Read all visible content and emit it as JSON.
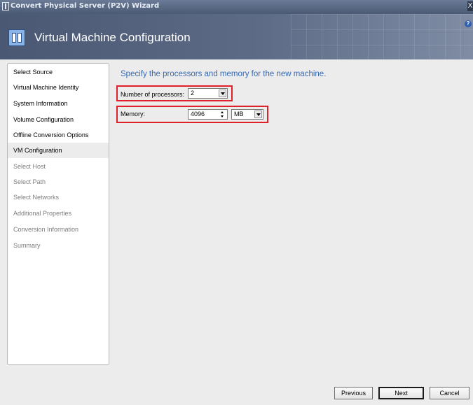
{
  "window": {
    "title": "Convert Physical Server (P2V) Wizard",
    "close_glyph": "X"
  },
  "banner": {
    "title": "Virtual Machine Configuration",
    "icon": "wizard-icon",
    "help_glyph": "?"
  },
  "nav": {
    "items": [
      {
        "label": "Select Source",
        "state": "done"
      },
      {
        "label": "Virtual Machine Identity",
        "state": "done"
      },
      {
        "label": "System Information",
        "state": "done"
      },
      {
        "label": "Volume Configuration",
        "state": "done"
      },
      {
        "label": "Offline Conversion Options",
        "state": "done"
      },
      {
        "label": "VM Configuration",
        "state": "active"
      },
      {
        "label": "Select Host",
        "state": "pending"
      },
      {
        "label": "Select Path",
        "state": "pending"
      },
      {
        "label": "Select Networks",
        "state": "pending"
      },
      {
        "label": "Additional Properties",
        "state": "pending"
      },
      {
        "label": "Conversion Information",
        "state": "pending"
      },
      {
        "label": "Summary",
        "state": "pending"
      }
    ]
  },
  "main": {
    "instruction": "Specify the processors and memory for the new machine.",
    "processors": {
      "label": "Number of processors:",
      "value": "2"
    },
    "memory": {
      "label": "Memory:",
      "value": "4096",
      "unit": "MB"
    }
  },
  "buttons": {
    "previous": "Previous",
    "next": "Next",
    "cancel": "Cancel"
  },
  "colors": {
    "accent_text": "#3568b5",
    "highlight_box": "#e0202a"
  }
}
